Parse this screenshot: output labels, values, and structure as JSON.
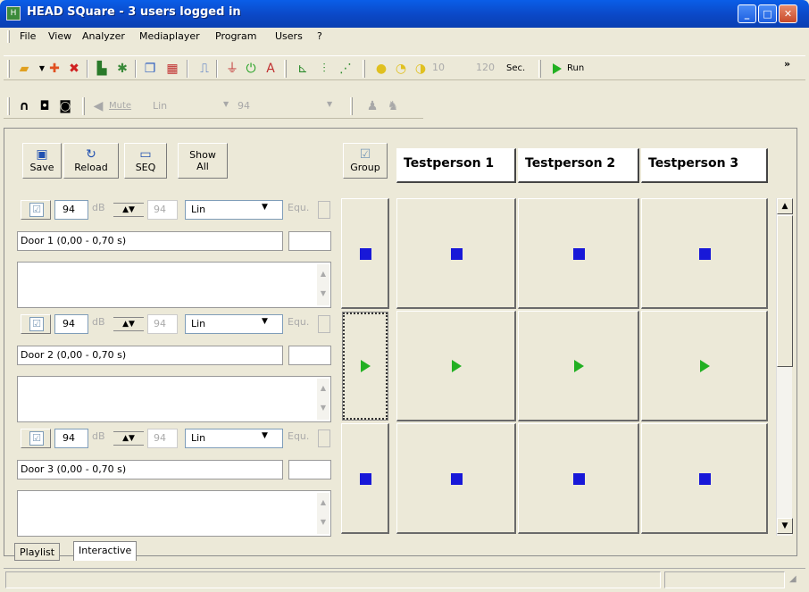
{
  "window": {
    "title": "HEAD SQuare - 3 users logged in",
    "app_icon": "head-square-app-icon"
  },
  "menu": {
    "items": [
      "File",
      "View",
      "Analyzer",
      "Mediaplayer",
      "Program",
      "Users",
      "?"
    ]
  },
  "toolbar1": {
    "time_field_1": "10",
    "time_field_2": "120",
    "sec_label": "Sec.",
    "run_label": "Run",
    "overflow": "»"
  },
  "toolbar2": {
    "mute_label": "Mute",
    "weighting": "Lin",
    "level": "94"
  },
  "panel": {
    "save_label": "Save",
    "reload_label": "Reload",
    "seq_label": "SEQ",
    "show_all_label": "Show All",
    "group_label": "Group"
  },
  "columns": [
    "Testperson 1",
    "Testperson 2",
    "Testperson 3"
  ],
  "rows": [
    {
      "level": "94",
      "db_unit": "dB",
      "level2": "94",
      "weighting": "Lin",
      "equ_label": "Equ.",
      "name": "Door 1 (0,00 - 0,70 s)",
      "state": "stop"
    },
    {
      "level": "94",
      "db_unit": "dB",
      "level2": "94",
      "weighting": "Lin",
      "equ_label": "Equ.",
      "name": "Door 2 (0,00 - 0,70 s)",
      "state": "play"
    },
    {
      "level": "94",
      "db_unit": "dB",
      "level2": "94",
      "weighting": "Lin",
      "equ_label": "Equ.",
      "name": "Door 3 (0,00 - 0,70 s)",
      "state": "stop"
    }
  ],
  "tabs": [
    "Playlist",
    "Interactive"
  ],
  "active_tab": "Interactive",
  "colors": {
    "stop": "#1818d8",
    "play": "#22b022",
    "titlebar": "#0a5ee8"
  }
}
